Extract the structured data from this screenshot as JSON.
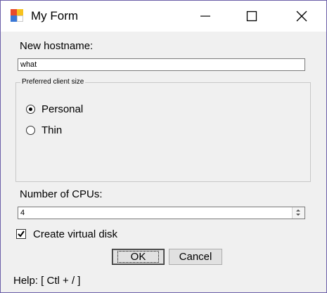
{
  "window": {
    "title": "My Form",
    "controls": {
      "minimize": "minimize",
      "maximize": "maximize",
      "close": "close"
    }
  },
  "form": {
    "hostname_label": "New hostname:",
    "hostname_value": "what",
    "client_group_label": "Preferred client size",
    "options": [
      {
        "label": "Personal",
        "selected": true
      },
      {
        "label": "Thin",
        "selected": false
      }
    ],
    "cpus_label": "Number of CPUs:",
    "cpus_value": "4",
    "virtual_disk_label": "Create virtual disk",
    "virtual_disk_checked": true,
    "ok_label": "OK",
    "cancel_label": "Cancel",
    "help_text": "Help: [ Ctl + / ]"
  },
  "colors": {
    "window_bg": "#f0f0f0",
    "titlebar_bg": "#ffffff",
    "border": "#6b5fa8"
  }
}
